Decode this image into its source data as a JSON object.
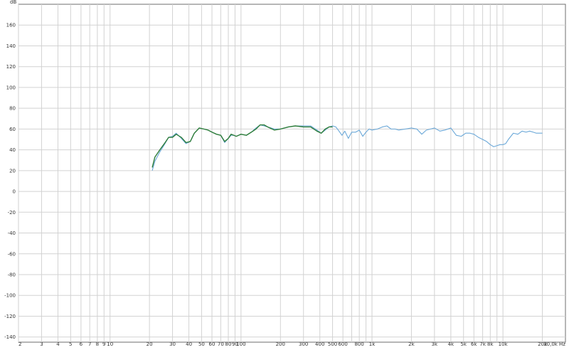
{
  "chart_data": {
    "type": "line",
    "title": "",
    "xlabel": "",
    "ylabel": "dB",
    "y_unit": "dB",
    "x_scale": "log",
    "xlim": [
      2,
      30000
    ],
    "ylim": [
      -145,
      180
    ],
    "grid": true,
    "y_ticks": [
      160,
      140,
      120,
      100,
      80,
      60,
      40,
      20,
      0,
      -20,
      -40,
      -60,
      -80,
      -100,
      -120,
      -140
    ],
    "x_ticks": [
      {
        "v": 2,
        "label": "2"
      },
      {
        "v": 3,
        "label": "3"
      },
      {
        "v": 4,
        "label": "4"
      },
      {
        "v": 5,
        "label": "5"
      },
      {
        "v": 6,
        "label": "6"
      },
      {
        "v": 7,
        "label": "7"
      },
      {
        "v": 8,
        "label": "8"
      },
      {
        "v": 9,
        "label": "9"
      },
      {
        "v": 10,
        "label": "10"
      },
      {
        "v": 20,
        "label": "20"
      },
      {
        "v": 30,
        "label": "30"
      },
      {
        "v": 40,
        "label": "40"
      },
      {
        "v": 50,
        "label": "50"
      },
      {
        "v": 60,
        "label": "60"
      },
      {
        "v": 70,
        "label": "70"
      },
      {
        "v": 80,
        "label": "80"
      },
      {
        "v": 90,
        "label": "90"
      },
      {
        "v": 100,
        "label": "100"
      },
      {
        "v": 200,
        "label": "200"
      },
      {
        "v": 300,
        "label": "300"
      },
      {
        "v": 400,
        "label": "400"
      },
      {
        "v": 500,
        "label": "500"
      },
      {
        "v": 600,
        "label": "600"
      },
      {
        "v": 800,
        "label": "800"
      },
      {
        "v": 1000,
        "label": "1k"
      },
      {
        "v": 2000,
        "label": "2k"
      },
      {
        "v": 3000,
        "label": "3k"
      },
      {
        "v": 4000,
        "label": "4k"
      },
      {
        "v": 5000,
        "label": "5k"
      },
      {
        "v": 6000,
        "label": "6k"
      },
      {
        "v": 7000,
        "label": "7k"
      },
      {
        "v": 8000,
        "label": "8k"
      },
      {
        "v": 10000,
        "label": "10k"
      },
      {
        "v": 20000,
        "label": "20k"
      },
      {
        "v": 30000,
        "label": "30,0k Hz"
      }
    ],
    "x_gridlines": [
      2,
      3,
      4,
      5,
      6,
      7,
      8,
      9,
      10,
      20,
      30,
      40,
      50,
      60,
      70,
      80,
      90,
      100,
      200,
      300,
      400,
      500,
      600,
      700,
      800,
      900,
      1000,
      2000,
      3000,
      4000,
      5000,
      6000,
      7000,
      8000,
      9000,
      10000,
      20000
    ],
    "series": [
      {
        "color": "#6ba8d8",
        "x": [
          21,
          22,
          24,
          26,
          28,
          30,
          32,
          35,
          38,
          41,
          44,
          48,
          52,
          56,
          60,
          65,
          70,
          75,
          80,
          84,
          88,
          92,
          96,
          100,
          110,
          120,
          130,
          140,
          150,
          160,
          180,
          200,
          230,
          260,
          300,
          340,
          380,
          410,
          440,
          470,
          500,
          530,
          560,
          590,
          620,
          660,
          700,
          750,
          800,
          850,
          900,
          950,
          1000,
          1100,
          1200,
          1300,
          1400,
          1500,
          1600,
          1800,
          2000,
          2200,
          2400,
          2600,
          2800,
          3000,
          3300,
          3600,
          4000,
          4400,
          4800,
          5200,
          5600,
          6000,
          6500,
          7000,
          7500,
          8000,
          8500,
          9000,
          9500,
          10000,
          10500,
          11000,
          12000,
          13000,
          14000,
          15000,
          16000,
          17000,
          18000,
          19000,
          20000
        ],
        "y": [
          20,
          29,
          38,
          45,
          52,
          53,
          56,
          51,
          46,
          48,
          56,
          61,
          60,
          59,
          57,
          55,
          54,
          47,
          51,
          54,
          54,
          53,
          54,
          55,
          54,
          57,
          61,
          64,
          63,
          62,
          60,
          60,
          62,
          63,
          63,
          63,
          59,
          56,
          59,
          62,
          63,
          62,
          58,
          54,
          58,
          51,
          57,
          57,
          59,
          53,
          57,
          60,
          59,
          60,
          62,
          63,
          60,
          60,
          59,
          60,
          61,
          60,
          55,
          59,
          60,
          61,
          58,
          59,
          61,
          54,
          53,
          56,
          56,
          55,
          52,
          50,
          48,
          45,
          43,
          44,
          45,
          45,
          46,
          50,
          56,
          55,
          58,
          57,
          58,
          57,
          56,
          56,
          56
        ]
      },
      {
        "color": "#2e7d3a",
        "x": [
          21,
          22,
          24,
          26,
          28,
          30,
          32,
          35,
          38,
          41,
          44,
          48,
          52,
          56,
          60,
          65,
          70,
          75,
          80,
          84,
          88,
          92,
          96,
          100,
          110,
          120,
          130,
          140,
          150,
          160,
          180,
          200,
          230,
          260,
          300,
          340,
          380,
          410,
          440,
          470,
          500
        ],
        "y": [
          23,
          33,
          40,
          46,
          52,
          52,
          55,
          52,
          47,
          48,
          56,
          61,
          60,
          59,
          57,
          55,
          54,
          48,
          51,
          55,
          54,
          53,
          54,
          55,
          54,
          57,
          60,
          64,
          64,
          62,
          59,
          60,
          62,
          63,
          62,
          62,
          58,
          56,
          60,
          62,
          62
        ]
      }
    ]
  }
}
